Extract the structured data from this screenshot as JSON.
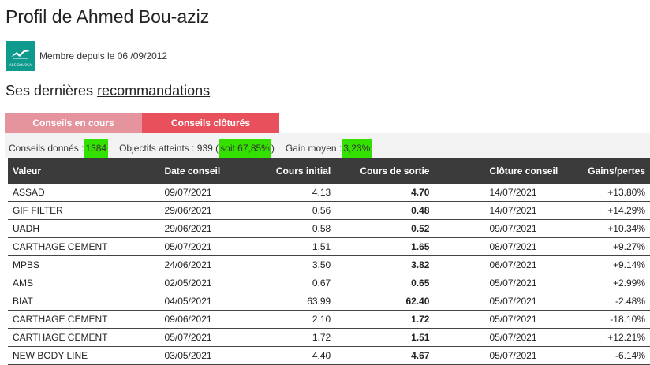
{
  "profile": {
    "title": "Profil de Ahmed Bou-aziz",
    "logo_text": "ABC BOURSA",
    "member_since": "Membre depuis le 06 /09/2012"
  },
  "section": {
    "title_prefix": "Ses dernières ",
    "title_link": "recommandations"
  },
  "tabs": [
    {
      "label": "Conseils en cours"
    },
    {
      "label": "Conseils clôturés"
    }
  ],
  "summary": {
    "given_label": "Conseils donnés : ",
    "given_value": "1384",
    "achieved_label": "Objectifs atteints : 939 (",
    "achieved_value": "soit 67,85%",
    "achieved_close": ")",
    "gain_label": "Gain moyen : ",
    "gain_value": "3,23%"
  },
  "table": {
    "headers": [
      "Valeur",
      "Date conseil",
      "Cours initial",
      "Cours de sortie",
      "Clôture conseil",
      "Gains/pertes"
    ],
    "rows": [
      {
        "valeur": "ASSAD",
        "date": "09/07/2021",
        "initial": "4.13",
        "sortie": "4.70",
        "cloture": "14/07/2021",
        "gain": "+13.80%",
        "trend": "pos"
      },
      {
        "valeur": "GIF FILTER",
        "date": "29/06/2021",
        "initial": "0.56",
        "sortie": "0.48",
        "cloture": "14/07/2021",
        "gain": "+14.29%",
        "trend": "pos"
      },
      {
        "valeur": "UADH",
        "date": "29/06/2021",
        "initial": "0.58",
        "sortie": "0.52",
        "cloture": "09/07/2021",
        "gain": "+10.34%",
        "trend": "pos"
      },
      {
        "valeur": "CARTHAGE CEMENT",
        "date": "05/07/2021",
        "initial": "1.51",
        "sortie": "1.65",
        "cloture": "08/07/2021",
        "gain": "+9.27%",
        "trend": "pos"
      },
      {
        "valeur": "MPBS",
        "date": "24/06/2021",
        "initial": "3.50",
        "sortie": "3.82",
        "cloture": "06/07/2021",
        "gain": "+9.14%",
        "trend": "pos"
      },
      {
        "valeur": "AMS",
        "date": "02/05/2021",
        "initial": "0.67",
        "sortie": "0.65",
        "cloture": "05/07/2021",
        "gain": "+2.99%",
        "trend": "pos"
      },
      {
        "valeur": "BIAT",
        "date": "04/05/2021",
        "initial": "63.99",
        "sortie": "62.40",
        "cloture": "05/07/2021",
        "gain": "-2.48%",
        "trend": "neg"
      },
      {
        "valeur": "CARTHAGE CEMENT",
        "date": "09/06/2021",
        "initial": "2.10",
        "sortie": "1.72",
        "cloture": "05/07/2021",
        "gain": "-18.10%",
        "trend": "neg"
      },
      {
        "valeur": "CARTHAGE CEMENT",
        "date": "05/07/2021",
        "initial": "1.72",
        "sortie": "1.51",
        "cloture": "05/07/2021",
        "gain": "+12.21%",
        "trend": "pos"
      },
      {
        "valeur": "NEW BODY LINE",
        "date": "03/05/2021",
        "initial": "4.40",
        "sortie": "4.67",
        "cloture": "05/07/2021",
        "gain": "-6.14%",
        "trend": "neg"
      }
    ]
  },
  "colors": {
    "accent": "#e8505c",
    "highlight": "#33e000",
    "positive": "#1a8a1a",
    "negative": "#e03030",
    "header_bg": "#3b3b3b",
    "logo_bg": "#0f9a8e"
  }
}
